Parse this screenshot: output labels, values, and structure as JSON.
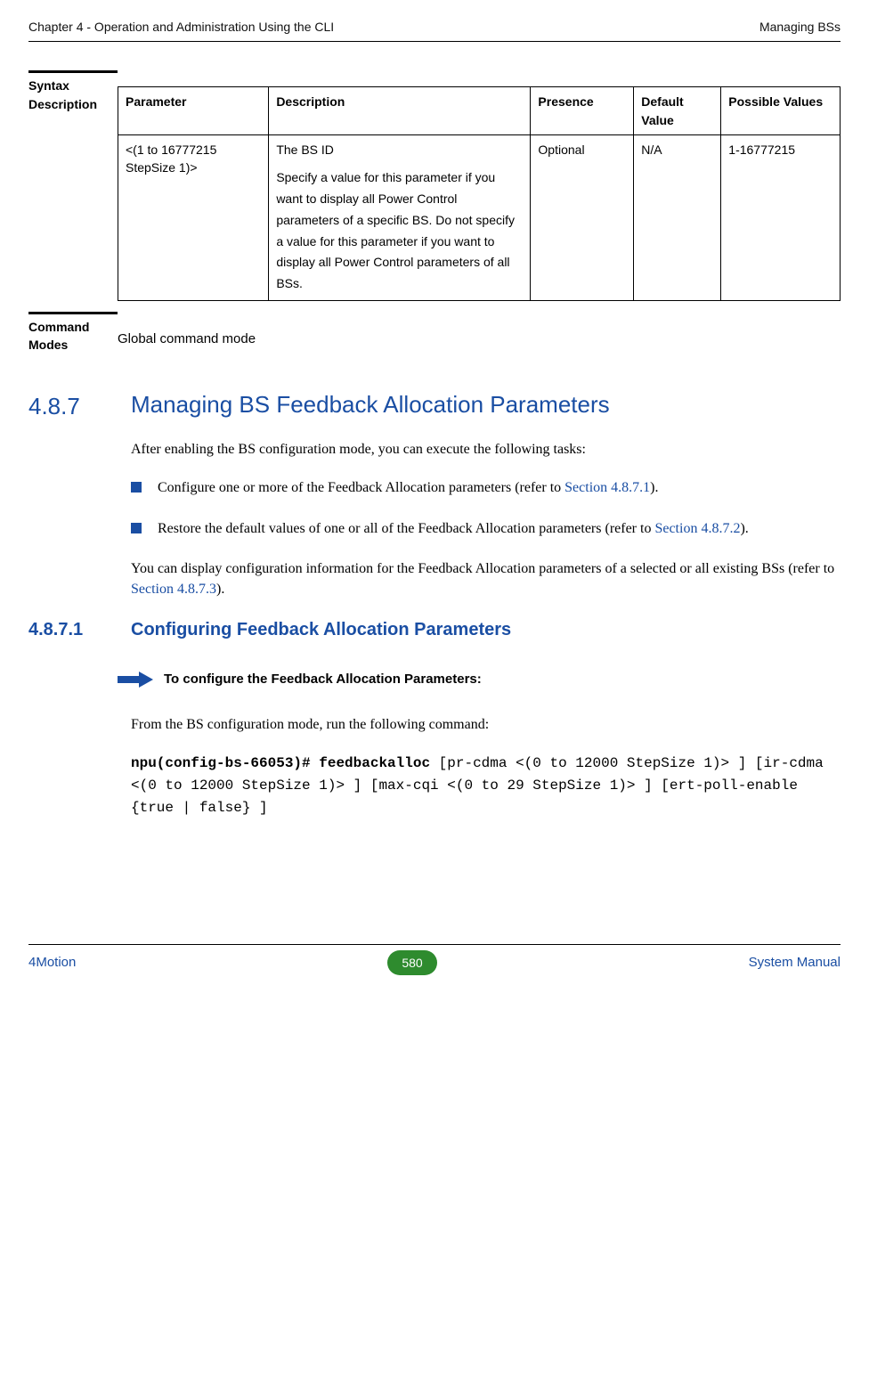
{
  "header": {
    "left": "Chapter 4 - Operation and Administration Using the CLI",
    "right": "Managing BSs"
  },
  "syntax": {
    "label_line1": "Syntax",
    "label_line2": "Description",
    "headers": {
      "c1": "Parameter",
      "c2": "Description",
      "c3": "Presence",
      "c4": "Default Value",
      "c5": "Possible Values"
    },
    "row1": {
      "parameter": "<(1 to 16777215 StepSize 1)>",
      "description_first": "The BS ID",
      "description_second": "Specify a value for this parameter if you want to display all Power Control parameters of a specific BS. Do not specify a value for this parameter if you want to display all Power Control parameters of all BSs.",
      "presence": "Optional",
      "default_value": "N/A",
      "possible_values": "1-16777215"
    }
  },
  "command_modes": {
    "label_line1": "Command",
    "label_line2": "Modes",
    "value": "Global command mode"
  },
  "section_487": {
    "number": "4.8.7",
    "title": "Managing BS Feedback Allocation Parameters",
    "intro": "After enabling the BS configuration mode, you can execute the following tasks:",
    "bullet1_pre": "Configure one or more of the Feedback Allocation parameters (refer to ",
    "bullet1_link": "Section 4.8.7.1",
    "bullet1_post": ").",
    "bullet2_pre": "Restore the default values of one or all of the Feedback Allocation parameters (refer to ",
    "bullet2_link": "Section 4.8.7.2",
    "bullet2_post": ").",
    "outro_pre": "You can display configuration information for the Feedback Allocation parameters of a selected or all existing BSs (refer to ",
    "outro_link": "Section 4.8.7.3",
    "outro_post": ")."
  },
  "section_4871": {
    "number": "4.8.7.1",
    "title": "Configuring Feedback Allocation Parameters",
    "arrow_label": "To configure the Feedback Allocation Parameters:",
    "cmd_intro": "From the BS configuration mode, run the following command:",
    "cmd_bold_1": "npu(config-bs-66053)# feedbackalloc",
    "cmd_rest_1": " [pr-cdma <(0 to 12000 StepSize 1)> ] [ir-cdma <(0 to 12000 StepSize 1)> ] [max-cqi <(0 to 29 StepSize 1)> ] [ert-poll-enable {true | false} ]"
  },
  "footer": {
    "left": "4Motion",
    "page": "580",
    "right": "System Manual"
  }
}
